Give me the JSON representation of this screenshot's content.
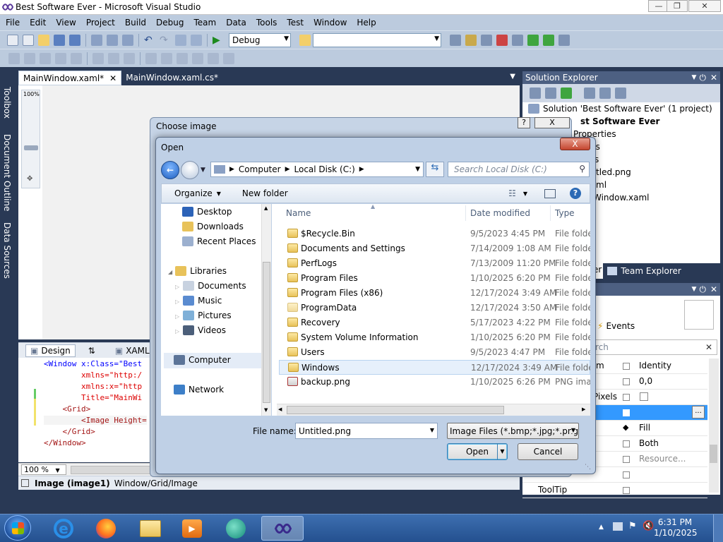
{
  "vs": {
    "title": "Best Software Ever - Microsoft Visual Studio",
    "menu": [
      "File",
      "Edit",
      "View",
      "Project",
      "Build",
      "Debug",
      "Team",
      "Data",
      "Tools",
      "Test",
      "Window",
      "Help"
    ],
    "config_combo": "Debug",
    "left_tabs": [
      "Toolbox",
      "Document Outline",
      "Data Sources"
    ],
    "doc_tabs": [
      "MainWindow.xaml*",
      "MainWindow.xaml.cs*"
    ],
    "zoom_percent_label": "100%",
    "design_tab": "Design",
    "xaml_tab": "XAML",
    "code_lines": [
      "<Window x:Class=\"Best",
      "        xmlns=\"http:/",
      "        xmlns:x=\"http",
      "        Title=\"MainWi",
      "    <Grid>",
      "        <Image Height=",
      "    </Grid>",
      "</Window>"
    ],
    "zoom_combo": "100 %",
    "breadcrumb_element": "Image (image1)",
    "breadcrumb_path": "Window/Grid/Image"
  },
  "solution_explorer": {
    "title": "Solution Explorer",
    "items": [
      "Solution 'Best Software Ever' (1 project)",
      "st Software Ever",
      "Properties",
      "nces",
      "s",
      "titled.png",
      "ml",
      "Window.xaml"
    ],
    "tab_partial": "er",
    "team_explorer": "Team Explorer"
  },
  "properties": {
    "events_label": "Events",
    "search_partial": "rch",
    "rows": [
      {
        "name": "m",
        "value": "Identity"
      },
      {
        "name": "",
        "value": "0,0"
      },
      {
        "name": "Pixels",
        "value": ""
      },
      {
        "name": "",
        "value": ""
      },
      {
        "name": "",
        "value": "Fill"
      },
      {
        "name": "",
        "value": "Both"
      },
      {
        "name": "",
        "value": "Resource..."
      },
      {
        "name": "",
        "value": ""
      },
      {
        "name": "ToolTip",
        "value": ""
      }
    ]
  },
  "choose_dialog": {
    "title": "Choose image",
    "help": "?",
    "close": "X"
  },
  "open_dialog": {
    "title": "Open",
    "close": "X",
    "breadcrumb": [
      "Computer",
      "Local Disk (C:)"
    ],
    "search_placeholder": "Search Local Disk (C:)",
    "organize": "Organize",
    "new_folder": "New folder",
    "nav_items": [
      {
        "label": "Desktop",
        "icon": "desktop-icon"
      },
      {
        "label": "Downloads",
        "icon": "downloads-icon"
      },
      {
        "label": "Recent Places",
        "icon": "recent-places-icon"
      },
      {
        "label": "Libraries",
        "icon": "libraries-icon"
      },
      {
        "label": "Documents",
        "icon": "documents-icon"
      },
      {
        "label": "Music",
        "icon": "music-icon"
      },
      {
        "label": "Pictures",
        "icon": "pictures-icon"
      },
      {
        "label": "Videos",
        "icon": "videos-icon"
      },
      {
        "label": "Computer",
        "icon": "computer-icon"
      },
      {
        "label": "Network",
        "icon": "network-icon"
      }
    ],
    "columns": {
      "name": "Name",
      "date": "Date modified",
      "type": "Type"
    },
    "files": [
      {
        "name": "$Recycle.Bin",
        "date": "9/5/2023 4:45 PM",
        "type": "File folder",
        "locked": true
      },
      {
        "name": "Documents and Settings",
        "date": "7/14/2009 1:08 AM",
        "type": "File folder",
        "locked": true
      },
      {
        "name": "PerfLogs",
        "date": "7/13/2009 11:20 PM",
        "type": "File folder",
        "locked": false
      },
      {
        "name": "Program Files",
        "date": "1/10/2025 6:20 PM",
        "type": "File folder",
        "locked": false
      },
      {
        "name": "Program Files (x86)",
        "date": "12/17/2024 3:49 AM",
        "type": "File folder",
        "locked": false
      },
      {
        "name": "ProgramData",
        "date": "12/17/2024 3:50 AM",
        "type": "File folder",
        "locked": false
      },
      {
        "name": "Recovery",
        "date": "5/17/2023 4:22 PM",
        "type": "File folder",
        "locked": false
      },
      {
        "name": "System Volume Information",
        "date": "1/10/2025 6:20 PM",
        "type": "File folder",
        "locked": false
      },
      {
        "name": "Users",
        "date": "9/5/2023 4:47 PM",
        "type": "File folder",
        "locked": false
      },
      {
        "name": "Windows",
        "date": "12/17/2024 3:49 AM",
        "type": "File folder",
        "locked": false,
        "selected": true
      },
      {
        "name": "backup.png",
        "date": "1/10/2025 6:26 PM",
        "type": "PNG imag",
        "locked": false,
        "png": true
      }
    ],
    "file_name_label": "File name:",
    "file_name_value": "Untitled.png",
    "file_type_value": "Image Files (*.bmp;*.jpg;*.png;",
    "open_button": "Open",
    "cancel_button": "Cancel"
  },
  "taskbar": {
    "time": "6:31 PM",
    "date": "1/10/2025"
  }
}
